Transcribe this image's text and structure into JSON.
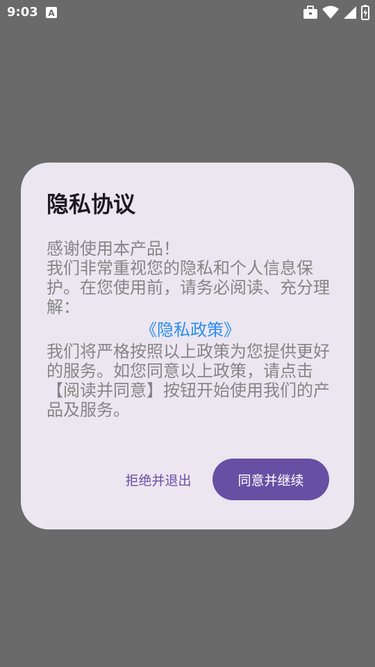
{
  "status_bar": {
    "time": "9:03",
    "icons": [
      "keyboard-a-icon",
      "briefcase-icon",
      "wifi-icon",
      "signal-icon",
      "battery-icon"
    ]
  },
  "dialog": {
    "title": "隐私协议",
    "body": {
      "line1": "感谢使用本产品！",
      "para1": "我们非常重视您的隐私和个人信息保护。在您使用前，请务必阅读、充分理解：",
      "policy_link": "《隐私政策》",
      "para2": "我们将严格按照以上政策为您提供更好的服务。如您同意以上政策，请点击【阅读并同意】按钮开始使用我们的产品及服务。"
    },
    "buttons": {
      "reject": "拒绝并退出",
      "agree": "同意并继续"
    }
  },
  "colors": {
    "scrim": "#6a6a6a",
    "dialog_bg": "#ece6f0",
    "primary": "#6750a4",
    "link": "#2b8ef0",
    "body_text": "#858585"
  }
}
